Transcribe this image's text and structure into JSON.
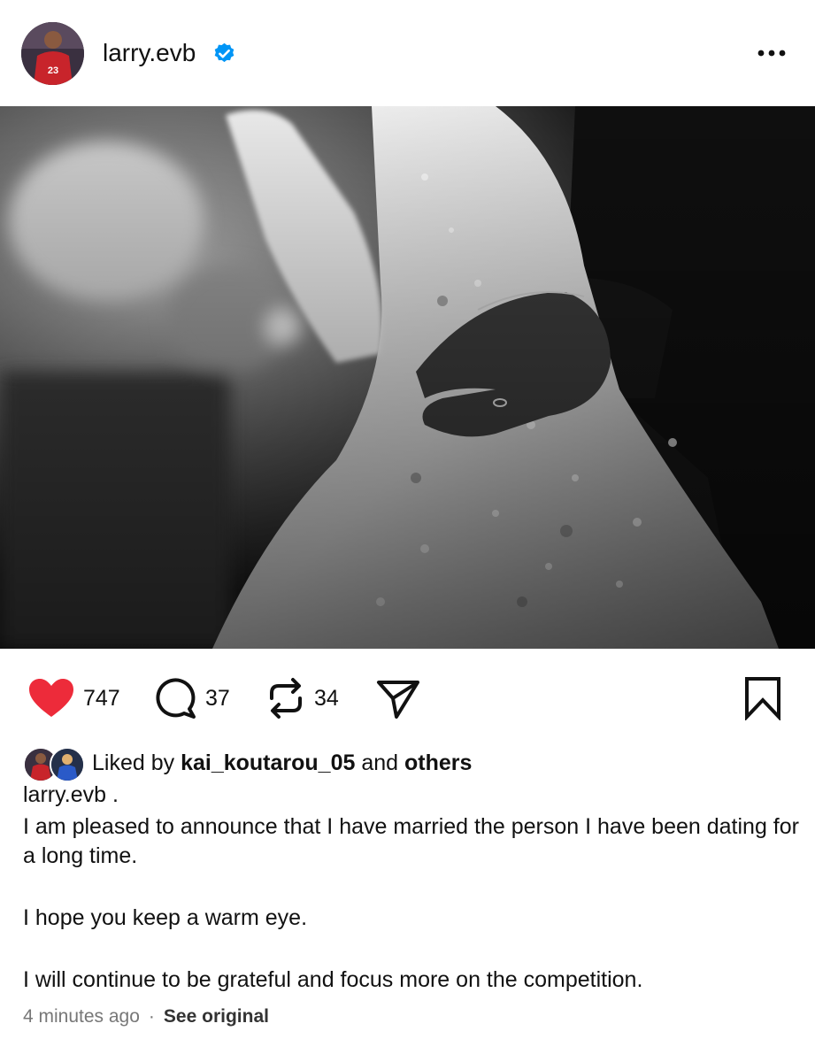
{
  "header": {
    "username": "larry.evb",
    "jersey_number": "23"
  },
  "actions": {
    "likes": "747",
    "comments": "37",
    "reposts": "34"
  },
  "liked_by": {
    "prefix": "Liked by",
    "user": "kai_koutarou_05",
    "middle": "and",
    "others": "others"
  },
  "caption": {
    "user": "larry.evb",
    "user_suffix": ".",
    "line1": "I am pleased to announce that I have married the person I have been dating for a long time.",
    "line2": "I hope you keep a warm eye.",
    "line3": "I will continue to be grateful and focus more on the competition."
  },
  "footer": {
    "time": "4 minutes ago",
    "separator": "·",
    "see_original": "See original"
  },
  "colors": {
    "heart": "#ED2B3A",
    "verified": "#0095F6",
    "jersey": "#C8242B"
  },
  "icons": [
    "more-icon",
    "heart-icon",
    "comment-icon",
    "repost-icon",
    "share-icon",
    "bookmark-icon",
    "verified-badge-icon"
  ]
}
